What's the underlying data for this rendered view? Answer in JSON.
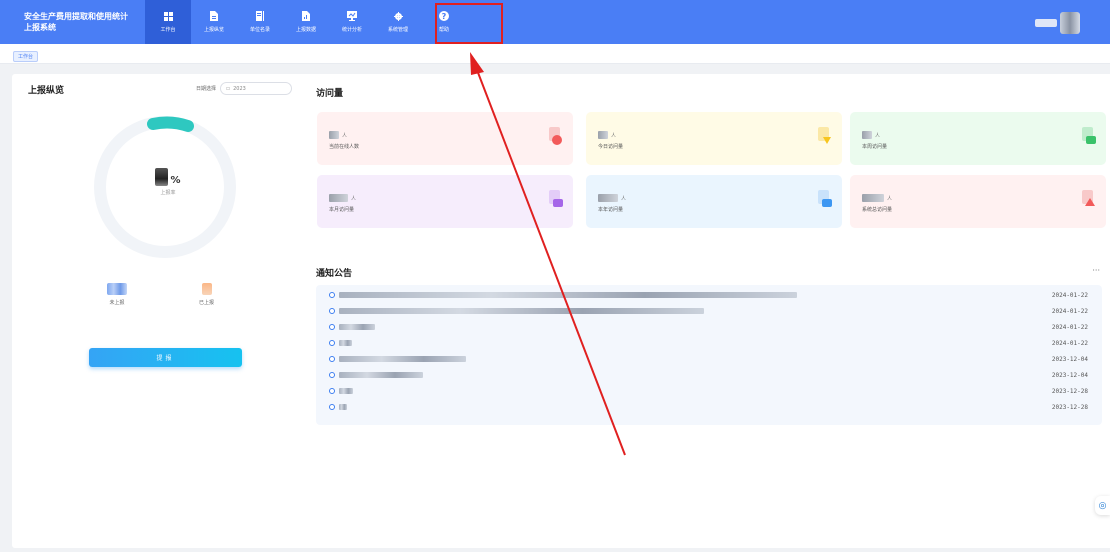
{
  "app": {
    "title_line1": "安全生产费用提取和使用统计",
    "title_line2": "上报系统"
  },
  "nav": [
    {
      "label": "工作台",
      "icon": "grid-icon"
    },
    {
      "label": "上报纵览",
      "icon": "report-overview-icon"
    },
    {
      "label": "单位名录",
      "icon": "unit-directory-icon"
    },
    {
      "label": "上报数据",
      "icon": "report-data-icon"
    },
    {
      "label": "统计分析",
      "icon": "statistics-icon"
    },
    {
      "label": "系统管理",
      "icon": "gear-icon"
    },
    {
      "label": "帮助",
      "icon": "help-icon"
    }
  ],
  "tab": {
    "label": "工作台"
  },
  "overview": {
    "title": "上报纵览",
    "date_label": "日期选择",
    "date_value": "2023",
    "percent_sign": "%",
    "percent_label": "上报率",
    "unreported_label": "未上报",
    "reported_label": "已上报",
    "report_button": "提报"
  },
  "visits": {
    "title": "访问量",
    "unit": "人",
    "cards": [
      {
        "label": "当前在线人数",
        "icon_color": "#f25a5a"
      },
      {
        "label": "今日访问量",
        "icon_color": "#f7c51e"
      },
      {
        "label": "本周访问量",
        "icon_color": "#3ac26a"
      },
      {
        "label": "本月访问量",
        "icon_color": "#a566e8"
      },
      {
        "label": "本年访问量",
        "icon_color": "#3d97f2"
      },
      {
        "label": "系统总访问量",
        "icon_color": "#f25a5a"
      }
    ]
  },
  "notices": {
    "title": "通知公告",
    "more": "···",
    "items": [
      {
        "date": "2024-01-22"
      },
      {
        "date": "2024-01-22"
      },
      {
        "date": "2024-01-22"
      },
      {
        "date": "2024-01-22"
      },
      {
        "date": "2023-12-04"
      },
      {
        "date": "2023-12-04"
      },
      {
        "date": "2023-12-28"
      },
      {
        "date": "2023-12-28"
      }
    ]
  },
  "colors": {
    "header": "#4a7ef5",
    "highlight": "#e02020",
    "accent": "#2ec8c0"
  }
}
